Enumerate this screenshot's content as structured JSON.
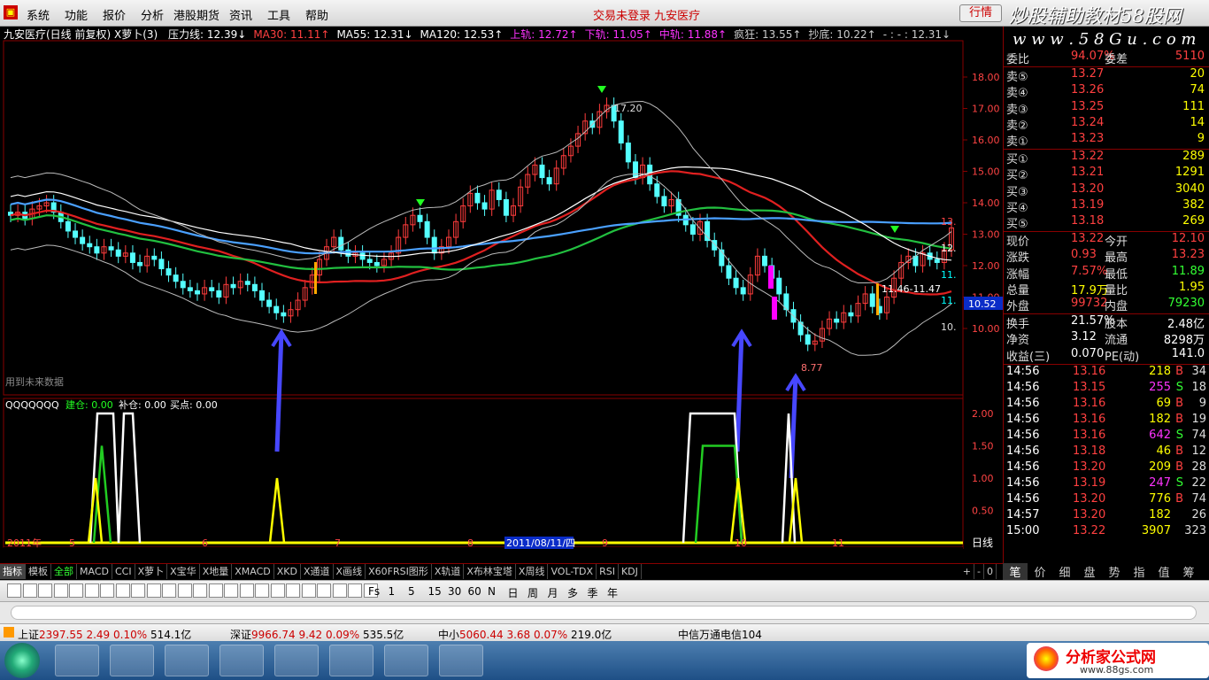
{
  "app": {
    "logo": "▣"
  },
  "menu": [
    "系统",
    "功能",
    "报价",
    "分析",
    "港股期货",
    "资讯",
    "工具",
    "帮助"
  ],
  "notice": "交易未登录  九安医疗",
  "hq_button": "行情",
  "watermark": "炒股辅助教材58股网",
  "watermark2": "w w w . 5 8 G u . c o m",
  "chart_title": {
    "name": "九安医疗(日线 前复权) X萝卜(3)",
    "items": [
      {
        "text": "压力线: 12.39↓",
        "color": "#fff"
      },
      {
        "text": "MA30: 11.11↑",
        "color": "#ff4040"
      },
      {
        "text": "MA55: 12.31↓",
        "color": "#fff"
      },
      {
        "text": "MA120: 12.53↑",
        "color": "#fff"
      },
      {
        "text": "上轨: 12.72↑",
        "color": "#f3f"
      },
      {
        "text": "下轨: 11.05↑",
        "color": "#f3f"
      },
      {
        "text": "中轨: 11.88↑",
        "color": "#f3f"
      },
      {
        "text": "疯狂: 13.55↑",
        "color": "#ccc"
      },
      {
        "text": "抄底: 10.22↑",
        "color": "#ccc"
      },
      {
        "text": "- : - : 12.31↓",
        "color": "#ccc"
      }
    ]
  },
  "price_axis": [
    "18.00",
    "17.00",
    "16.00",
    "15.00",
    "14.00",
    "13.00",
    "12.00",
    "11.00",
    "10.00"
  ],
  "price_current": "10.52",
  "price_labels": {
    "high": "17.20",
    "low": "8.77",
    "range": "11.46-11.47",
    "right1": "13.",
    "right2": "12.",
    "right3": "11.",
    "right4": "11.",
    "right5": "10."
  },
  "no_future_data": "用到未来数据",
  "indicator_title": {
    "name": "QQQQQQQ",
    "jiancang": "建仓: 0.00",
    "bucang": "补仓: 0.00",
    "maidian": "买点: 0.00"
  },
  "indicator_axis": [
    "2.00",
    "1.50",
    "1.00",
    "0.50"
  ],
  "time_axis": {
    "labels": [
      "2011年",
      "5",
      "6",
      "7",
      "8",
      "2011/08/11/四",
      "9",
      "10",
      "11"
    ],
    "period": "日线"
  },
  "tabs": [
    "指标",
    "模板",
    "全部",
    "MACD",
    "CCI",
    "X萝卜",
    "X宝华",
    "X地量",
    "XMACD",
    "XKD",
    "X通道",
    "X画线",
    "X60FRSI图形",
    "X轨道",
    "X布林宝塔",
    "X周线",
    "VOL-TDX",
    "RSI",
    "KDJ"
  ],
  "tab_right": [
    "+",
    "-",
    "0"
  ],
  "right_tabs": [
    "笔",
    "价",
    "细",
    "盘",
    "势",
    "指",
    "值",
    "筹"
  ],
  "quote": {
    "weibi": {
      "label": "委比",
      "value": "94.07%",
      "label2": "委差",
      "value2": "5110"
    },
    "sells": [
      {
        "label": "卖⑤",
        "price": "13.27",
        "vol": "20"
      },
      {
        "label": "卖④",
        "price": "13.26",
        "vol": "74"
      },
      {
        "label": "卖③",
        "price": "13.25",
        "vol": "111"
      },
      {
        "label": "卖②",
        "price": "13.24",
        "vol": "14"
      },
      {
        "label": "卖①",
        "price": "13.23",
        "vol": "9"
      }
    ],
    "buys": [
      {
        "label": "买①",
        "price": "13.22",
        "vol": "289"
      },
      {
        "label": "买②",
        "price": "13.21",
        "vol": "1291"
      },
      {
        "label": "买③",
        "price": "13.20",
        "vol": "3040"
      },
      {
        "label": "买④",
        "price": "13.19",
        "vol": "382"
      },
      {
        "label": "买⑤",
        "price": "13.18",
        "vol": "269"
      }
    ],
    "stats": [
      {
        "l1": "现价",
        "v1": "13.22",
        "l2": "今开",
        "v2": "12.10"
      },
      {
        "l1": "涨跌",
        "v1": "0.93",
        "l2": "最高",
        "v2": "13.23"
      },
      {
        "l1": "涨幅",
        "v1": "7.57%",
        "l2": "最低",
        "v2": "11.89"
      },
      {
        "l1": "总量",
        "v1": "17.9万",
        "l2": "量比",
        "v2": "1.95"
      },
      {
        "l1": "外盘",
        "v1": "99732",
        "l2": "内盘",
        "v2": "79230"
      }
    ],
    "stats2": [
      {
        "l1": "换手",
        "v1": "21.57%",
        "l2": "股本",
        "v2": "2.48亿"
      },
      {
        "l1": "净资",
        "v1": "3.12",
        "l2": "流通",
        "v2": "8298万"
      },
      {
        "l1": "收益(三)",
        "v1": "0.070",
        "l2": "PE(动)",
        "v2": "141.0"
      }
    ]
  },
  "ticks": [
    {
      "time": "14:56",
      "price": "13.16",
      "vol": "218",
      "bs": "B",
      "n": "34"
    },
    {
      "time": "14:56",
      "price": "13.15",
      "vol": "255",
      "bs": "S",
      "n": "18"
    },
    {
      "time": "14:56",
      "price": "13.16",
      "vol": "69",
      "bs": "B",
      "n": "9"
    },
    {
      "time": "14:56",
      "price": "13.16",
      "vol": "182",
      "bs": "B",
      "n": "19"
    },
    {
      "time": "14:56",
      "price": "13.16",
      "vol": "642",
      "bs": "S",
      "n": "74"
    },
    {
      "time": "14:56",
      "price": "13.18",
      "vol": "46",
      "bs": "B",
      "n": "12"
    },
    {
      "time": "14:56",
      "price": "13.20",
      "vol": "209",
      "bs": "B",
      "n": "28"
    },
    {
      "time": "14:56",
      "price": "13.19",
      "vol": "247",
      "bs": "S",
      "n": "22"
    },
    {
      "time": "14:56",
      "price": "13.20",
      "vol": "776",
      "bs": "B",
      "n": "74"
    },
    {
      "time": "14:57",
      "price": "13.20",
      "vol": "182",
      "bs": "",
      "n": "26"
    },
    {
      "time": "15:00",
      "price": "13.22",
      "vol": "3907",
      "bs": "",
      "n": "323"
    }
  ],
  "toolbar_periods": [
    "Fs",
    "1",
    "5",
    "15",
    "30",
    "60",
    "N",
    "日",
    "周",
    "月",
    "多",
    "季",
    "年"
  ],
  "status": [
    {
      "name": "上证",
      "val": "2397.55",
      "chg": "2.49",
      "pct": "0.10%",
      "amt": "514.1亿"
    },
    {
      "name": "深证",
      "val": "9966.74",
      "chg": "9.42",
      "pct": "0.09%",
      "amt": "535.5亿"
    },
    {
      "name": "中小",
      "val": "5060.44",
      "chg": "3.68",
      "pct": "0.07%",
      "amt": "219.0亿"
    }
  ],
  "status_right": "中信万通电信104",
  "taskbar_brand": "分析家公式网",
  "taskbar_url": "www.88gs.com"
}
